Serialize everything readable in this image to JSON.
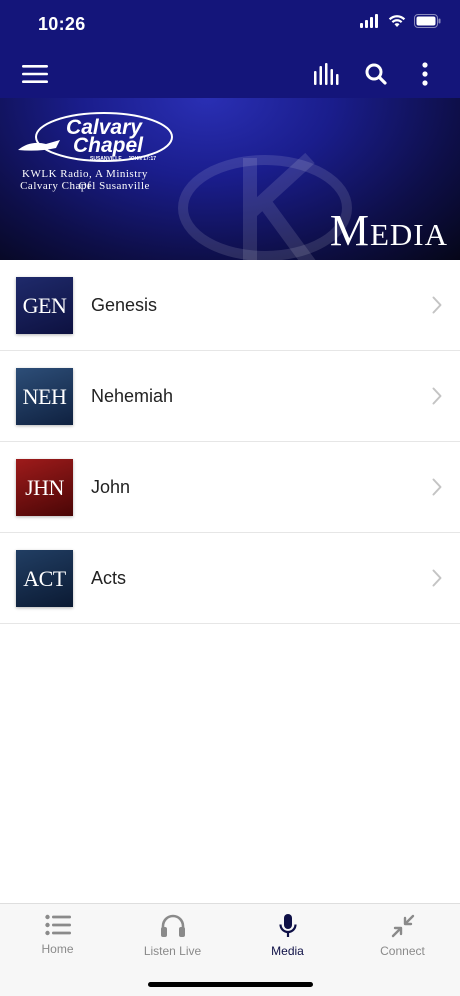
{
  "status_bar": {
    "time": "10:26"
  },
  "navbar": {
    "icons": [
      "menu-icon",
      "equalizer-icon",
      "search-icon",
      "more-vertical-icon"
    ],
    "bg_color": "#14157a"
  },
  "banner": {
    "logo_line1": "KWLK Radio, A Ministry Of",
    "logo_line2": "Calvary Chapel Susanville",
    "title": "Media"
  },
  "list": {
    "items": [
      {
        "abbr": "GEN",
        "label": "Genesis"
      },
      {
        "abbr": "NEH",
        "label": "Nehemiah"
      },
      {
        "abbr": "JHN",
        "label": "John"
      },
      {
        "abbr": "ACT",
        "label": "Acts"
      }
    ]
  },
  "tabbar": {
    "tabs": [
      {
        "label": "Home",
        "icon": "list-icon",
        "active": false
      },
      {
        "label": "Listen Live",
        "icon": "headphones-icon",
        "active": false
      },
      {
        "label": "Media",
        "icon": "microphone-icon",
        "active": true
      },
      {
        "label": "Connect",
        "icon": "compress-arrows-icon",
        "active": false
      }
    ]
  }
}
